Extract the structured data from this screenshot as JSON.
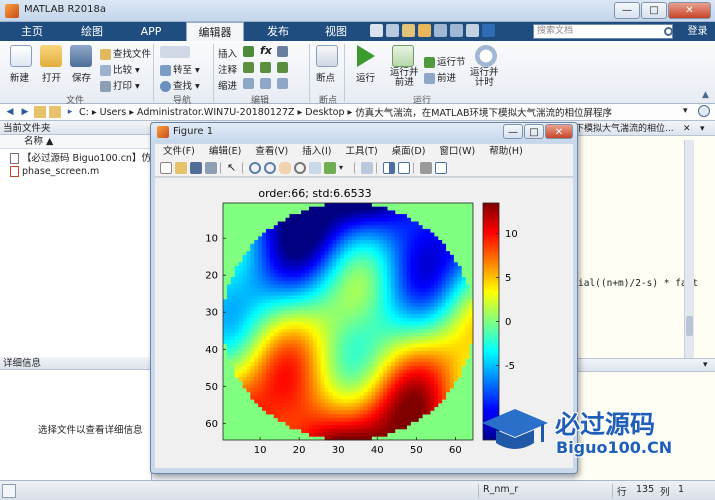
{
  "window": {
    "title": "MATLAB R2018a",
    "minimize": "—",
    "maximize": "□",
    "close": "✕"
  },
  "tabs": [
    {
      "label": "主页",
      "active": false
    },
    {
      "label": "绘图",
      "active": false
    },
    {
      "label": "APP",
      "active": false
    },
    {
      "label": "编辑器",
      "active": true
    },
    {
      "label": "发布",
      "active": false
    },
    {
      "label": "视图",
      "active": false
    }
  ],
  "search": {
    "placeholder": "搜索文档"
  },
  "login_label": "登录",
  "ribbon": {
    "file": {
      "group": "文件",
      "new": "新建",
      "open": "打开",
      "save": "保存",
      "find_files": "查找文件",
      "compare": "比较",
      "print": "打印"
    },
    "nav": {
      "group": "导航",
      "goto": "转至",
      "find": "查找"
    },
    "edit": {
      "group": "编辑",
      "insert": "插入",
      "comment": "注释",
      "indent": "缩进"
    },
    "breakpoints": {
      "group": "断点",
      "breakpoint": "断点"
    },
    "run": {
      "group": "运行",
      "run": "运行",
      "run_advance": "运行并\n前进",
      "run_section": "运行节",
      "advance": "前进",
      "run_time": "运行并\n计时"
    }
  },
  "address": {
    "segments": [
      "C:",
      "Users",
      "Administrator.WIN7U-20180127Z",
      "Desktop",
      "仿真大气湍流，在MATLAB环境下模拟大气湍流的相位屏程序"
    ]
  },
  "left_panel": {
    "title": "当前文件夹",
    "col_header": "名称",
    "sort_indicator": "▲",
    "files": [
      "【必过源码 Biguo100.cn】仿",
      "phase_screen.m"
    ],
    "details_title": "详细信息",
    "details_empty": "选择文件以查看详细信息"
  },
  "editor": {
    "tab_label": "下模拟大气湍流的相位...",
    "code_fragment": "ial((n+m)/2-s) * fact"
  },
  "status": {
    "var_name": "R_nm_r",
    "row_label": "行",
    "row": "135",
    "col_label": "列",
    "col": "1"
  },
  "figure": {
    "title": "Figure 1",
    "menus": [
      "文件(F)",
      "编辑(E)",
      "查看(V)",
      "插入(I)",
      "工具(T)",
      "桌面(D)",
      "窗口(W)",
      "帮助(H)"
    ],
    "plot_title": "order:66;  std:6.6533"
  },
  "watermark": {
    "brand": "必过源码",
    "url": "Biguo100.CN"
  },
  "chart_data": {
    "type": "heatmap",
    "title": "order:66;  std:6.6533",
    "xlim": [
      0.5,
      64.5
    ],
    "ylim": [
      0.5,
      64.5
    ],
    "y_reversed": true,
    "xticks": [
      10,
      20,
      30,
      40,
      50,
      60
    ],
    "yticks": [
      10,
      20,
      30,
      40,
      50,
      60
    ],
    "colorbar": {
      "ticks": [
        10,
        5,
        0,
        -5
      ],
      "range": [
        -13.5,
        13.5
      ],
      "colormap": "jet"
    },
    "background_color": "#80ff80",
    "grid_size": 64,
    "circular_aperture": true,
    "aperture_radius": 32
  }
}
